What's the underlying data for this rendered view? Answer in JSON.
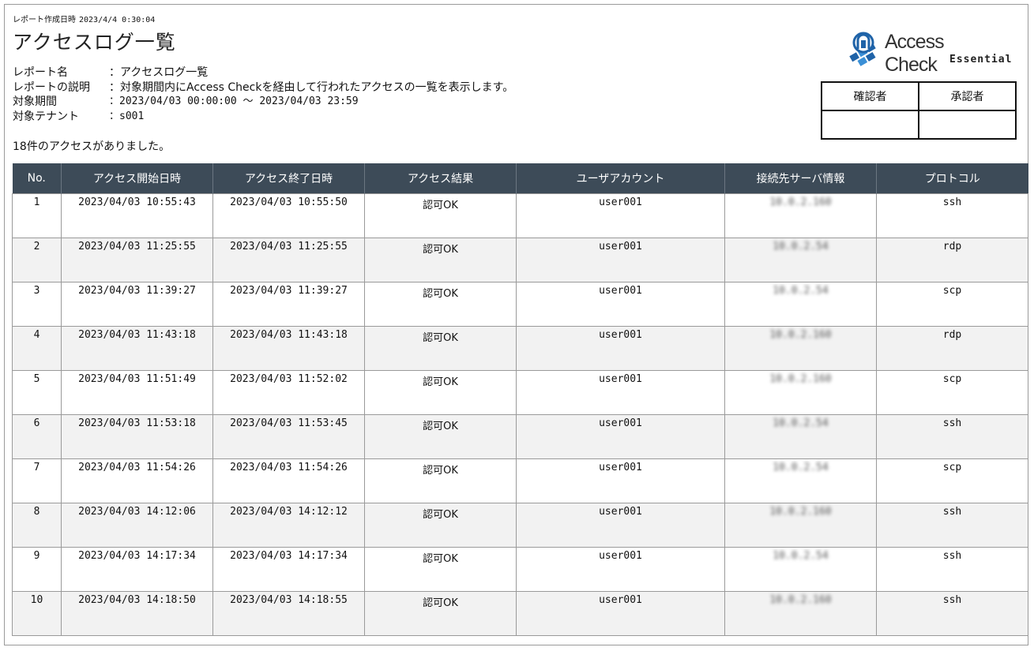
{
  "report_created": {
    "label": "レポート作成日時",
    "value": "2023/4/4 0:30:04"
  },
  "title": "アクセスログ一覧",
  "meta": [
    {
      "label": "レポート名",
      "value": "：アクセスログ一覧"
    },
    {
      "label": "レポートの説明",
      "value": "：対象期間内にAccess Checkを経由して行われたアクセスの一覧を表示します。"
    },
    {
      "label": "対象期間",
      "value": "：2023/04/03 00:00:00 ～ 2023/04/03 23:59"
    },
    {
      "label": "対象テナント",
      "value": "：s001"
    }
  ],
  "summary": "18件のアクセスがありました。",
  "logo": {
    "name": "Access Check",
    "edition": "Essential",
    "icon": "access-check-logo-icon",
    "colors": [
      "#1f63a8",
      "#3a8fd6"
    ]
  },
  "approval": {
    "checker": "確認者",
    "approver": "承認者"
  },
  "table": {
    "columns": [
      "No.",
      "アクセス開始日時",
      "アクセス終了日時",
      "アクセス結果",
      "ユーザアカウント",
      "接続先サーバ情報",
      "プロトコル"
    ],
    "rows": [
      {
        "no": "1",
        "start": "2023/04/03 10:55:43",
        "end": "2023/04/03 10:55:50",
        "result": "認可OK",
        "user": "user001",
        "server": "10.0.2.160",
        "protocol": "ssh"
      },
      {
        "no": "2",
        "start": "2023/04/03 11:25:55",
        "end": "2023/04/03 11:25:55",
        "result": "認可OK",
        "user": "user001",
        "server": "10.0.2.54",
        "protocol": "rdp"
      },
      {
        "no": "3",
        "start": "2023/04/03 11:39:27",
        "end": "2023/04/03 11:39:27",
        "result": "認可OK",
        "user": "user001",
        "server": "10.0.2.54",
        "protocol": "scp"
      },
      {
        "no": "4",
        "start": "2023/04/03 11:43:18",
        "end": "2023/04/03 11:43:18",
        "result": "認可OK",
        "user": "user001",
        "server": "10.0.2.160",
        "protocol": "rdp"
      },
      {
        "no": "5",
        "start": "2023/04/03 11:51:49",
        "end": "2023/04/03 11:52:02",
        "result": "認可OK",
        "user": "user001",
        "server": "10.0.2.160",
        "protocol": "scp"
      },
      {
        "no": "6",
        "start": "2023/04/03 11:53:18",
        "end": "2023/04/03 11:53:45",
        "result": "認可OK",
        "user": "user001",
        "server": "10.0.2.54",
        "protocol": "ssh"
      },
      {
        "no": "7",
        "start": "2023/04/03 11:54:26",
        "end": "2023/04/03 11:54:26",
        "result": "認可OK",
        "user": "user001",
        "server": "10.0.2.54",
        "protocol": "scp"
      },
      {
        "no": "8",
        "start": "2023/04/03 14:12:06",
        "end": "2023/04/03 14:12:12",
        "result": "認可OK",
        "user": "user001",
        "server": "10.0.2.160",
        "protocol": "ssh"
      },
      {
        "no": "9",
        "start": "2023/04/03 14:17:34",
        "end": "2023/04/03 14:17:34",
        "result": "認可OK",
        "user": "user001",
        "server": "10.0.2.54",
        "protocol": "ssh"
      },
      {
        "no": "10",
        "start": "2023/04/03 14:18:50",
        "end": "2023/04/03 14:18:55",
        "result": "認可OK",
        "user": "user001",
        "server": "10.0.2.160",
        "protocol": "ssh"
      }
    ]
  }
}
